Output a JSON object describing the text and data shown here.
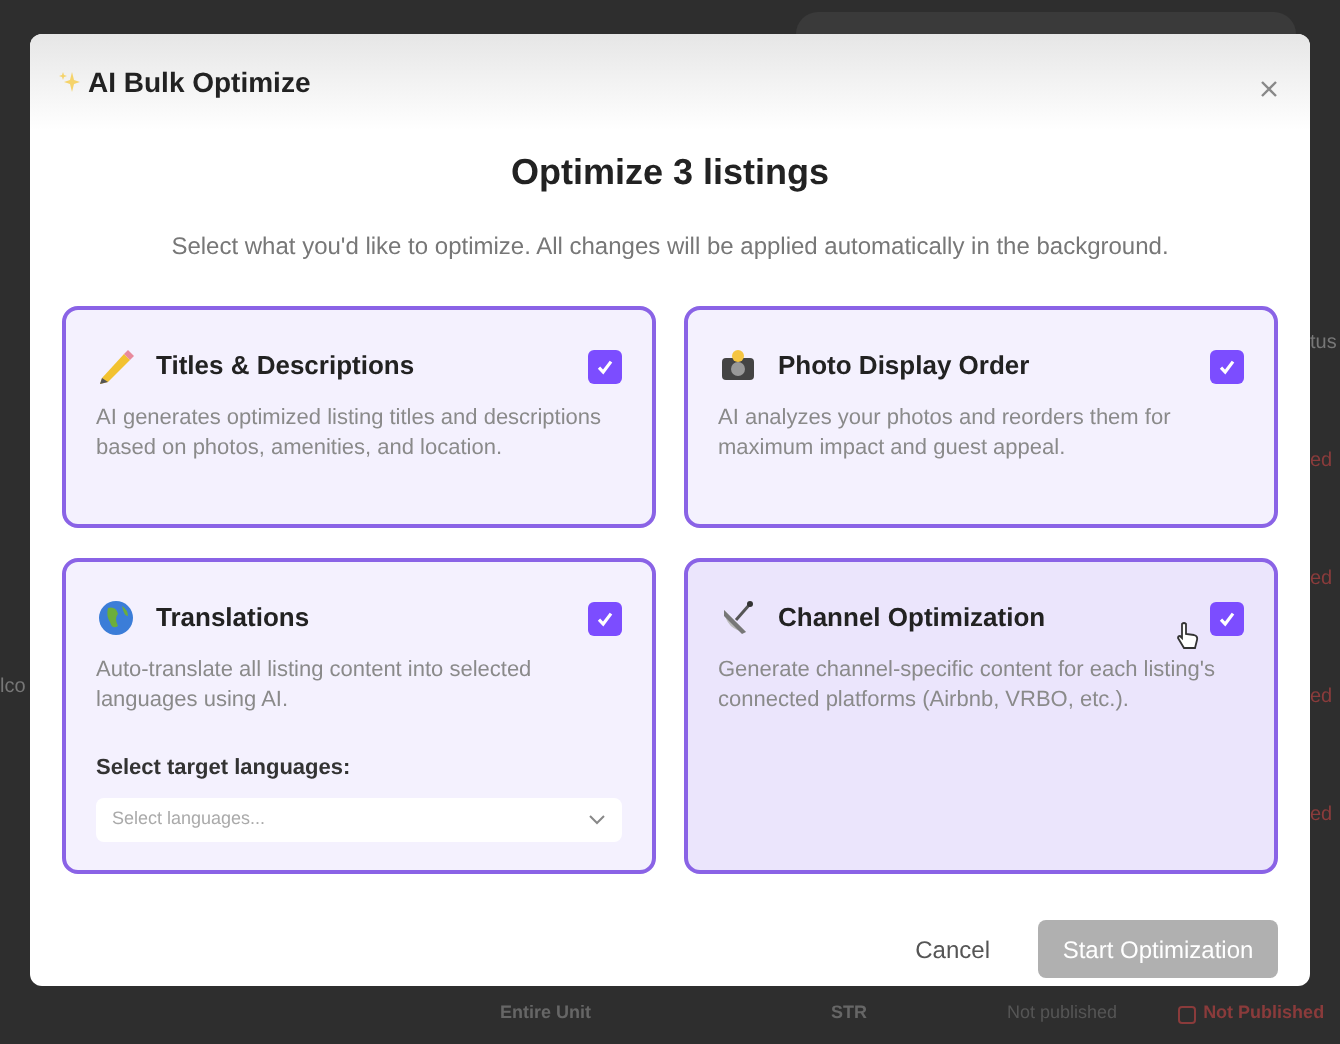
{
  "background": {
    "right_fragments": [
      "tus",
      "ed",
      "ed",
      "ed",
      "ed"
    ],
    "left_fragment": "lco",
    "bottom_row": [
      "Entire Unit",
      "STR",
      "Not published",
      "Not Published"
    ]
  },
  "dialog": {
    "title": "AI Bulk Optimize",
    "heading": "Optimize 3 listings",
    "subtitle": "Select what you'd like to optimize. All changes will be applied automatically in the background.",
    "options": [
      {
        "kind": "pencil",
        "title": "Titles & Descriptions",
        "description": "AI generates optimized listing titles and descriptions based on photos, amenities, and location.",
        "checked": true,
        "hovered": false
      },
      {
        "kind": "camera",
        "title": "Photo Display Order",
        "description": "AI analyzes your photos and reorders them for maximum impact and guest appeal.",
        "checked": true,
        "hovered": false
      },
      {
        "kind": "globe",
        "title": "Translations",
        "description": "Auto-translate all listing content into selected languages using AI.",
        "checked": true,
        "hovered": false,
        "field_label": "Select target languages:",
        "placeholder": "Select languages..."
      },
      {
        "kind": "satellite",
        "title": "Channel Optimization",
        "description": "Generate channel-specific content for each listing's connected platforms (Airbnb, VRBO, etc.).",
        "checked": true,
        "hovered": true
      }
    ],
    "cancel": "Cancel",
    "start": {
      "label": "Start Optimization",
      "disabled": true
    }
  }
}
